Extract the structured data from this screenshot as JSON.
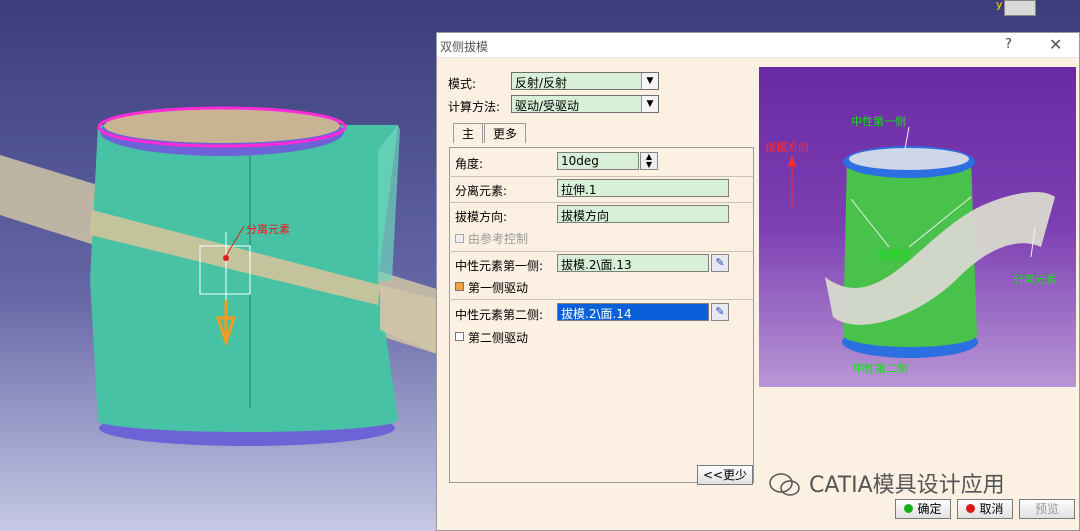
{
  "viewport": {
    "annotation_label": "分离元素",
    "axis_label": "y"
  },
  "dialog": {
    "title": "双侧拔模",
    "help": "?",
    "close": "✕",
    "mode_label": "模式:",
    "mode_value": "反射/反射",
    "calc_label": "计算方法:",
    "calc_value": "驱动/受驱动",
    "tabs": [
      "主",
      "更多"
    ],
    "angle_label": "角度:",
    "angle_value": "10deg",
    "parting_label": "分离元素:",
    "parting_value": "拉伸.1",
    "pull_label": "拔模方向:",
    "pull_value": "拔模方向",
    "ref_control_label": "由参考控制",
    "neutral1_label": "中性元素第一侧:",
    "neutral1_value": "拔模.2\\面.13",
    "drive1_label": "第一侧驱动",
    "drive1_checked": true,
    "neutral2_label": "中性元素第二侧:",
    "neutral2_value": "拔模.2\\面.14",
    "drive2_label": "第二侧驱动",
    "drive2_checked": false,
    "less_button": "<<更少",
    "ok_button": "确定",
    "cancel_button": "取消",
    "preview_button": "预览"
  },
  "preview_image": {
    "label_neutral_first": "中性第一侧",
    "label_pull_dir": "拔模方向",
    "label_parting": "分离元素",
    "label_draft_face": "拔模面",
    "label_neutral_second": "中性第二侧"
  },
  "watermark": "CATIA模具设计应用",
  "colors": {
    "viewport_bg_top": "#3b3e7a",
    "part_green": "#4cc8a6",
    "highlight_magenta": "#ff2bd8",
    "field_green": "#d8f0d8",
    "selected_blue": "#0a60d8",
    "dialog_bg": "#fbf0e2",
    "preview_purple": "#7d3fb2"
  }
}
